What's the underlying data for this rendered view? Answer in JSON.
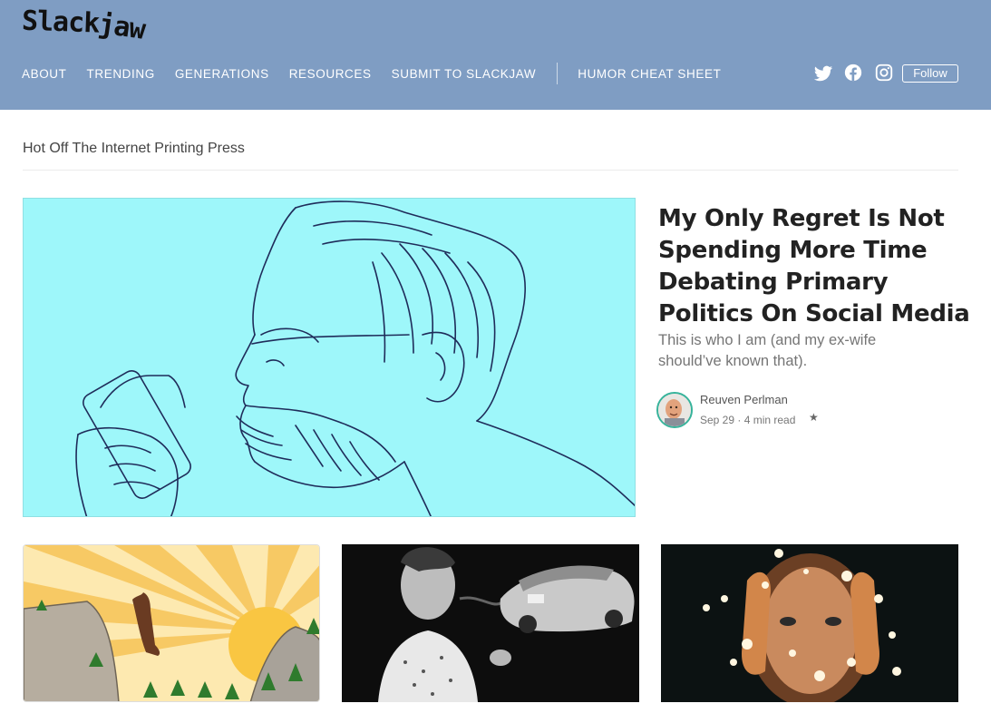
{
  "header": {
    "logo": "Slackjaw",
    "logo_part1": "Slack",
    "logo_part2": "jaw",
    "nav": [
      {
        "label": "ABOUT"
      },
      {
        "label": "TRENDING"
      },
      {
        "label": "GENERATIONS"
      },
      {
        "label": "RESOURCES"
      },
      {
        "label": "SUBMIT TO SLACKJAW"
      }
    ],
    "nav_extra": {
      "label": "HUMOR CHEAT SHEET"
    },
    "social": [
      "twitter-icon",
      "facebook-icon",
      "instagram-icon"
    ],
    "follow_label": "Follow",
    "bg_color": "#7f9dc3"
  },
  "section": {
    "title": "Hot Off The Internet Printing Press"
  },
  "featured": {
    "title": "My Only Regret Is Not Spending More Time Debating Primary Politics On Social Media",
    "subtitle": "This is who I am (and my ex-wife should’ve known that).",
    "author": "Reuven Perlman",
    "date": "Sep 29",
    "read_time": "4 min read",
    "meta": "Sep 29 · 4 min read",
    "image_bg": "#9ef7fa"
  },
  "cards": [
    {
      "image": "sunrise-illustration"
    },
    {
      "image": "man-smoking-photo"
    },
    {
      "image": "woman-lights-photo"
    }
  ]
}
